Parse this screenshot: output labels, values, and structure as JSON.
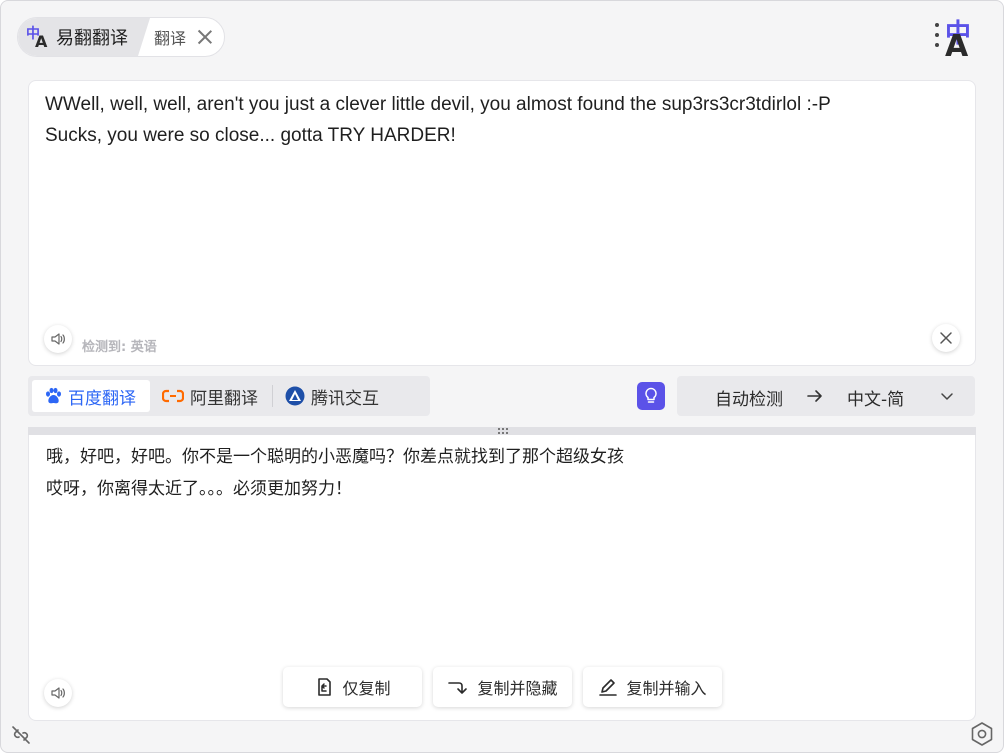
{
  "tabs": [
    {
      "label": "易翻翻译",
      "active": true
    },
    {
      "label": "翻译",
      "active": false
    }
  ],
  "app_glyph": {
    "top": "中",
    "bottom": "A"
  },
  "logo": {
    "top": "中",
    "bottom": "A",
    "icon": "translate-logo-icon"
  },
  "source": {
    "text": "WWell, well, well, aren't you just a clever little devil, you almost found the sup3rs3cr3tdirlol :-P\nSucks, you were so close... gotta TRY HARDER!",
    "detected_label": "检测到: 英语"
  },
  "engines": [
    {
      "label": "百度翻译",
      "icon": "baidu-paw-icon",
      "active": true,
      "color": "#2c66f5"
    },
    {
      "label": "阿里翻译",
      "icon": "alibaba-icon",
      "active": false,
      "color": "#ff6a00"
    },
    {
      "label": "腾讯交互",
      "icon": "tencent-icon",
      "active": false,
      "color": "#1e4fa8"
    }
  ],
  "language": {
    "from": "自动检测",
    "to": "中文-简"
  },
  "target": {
    "text": "哦，好吧，好吧。你不是一个聪明的小恶魔吗？你差点就找到了那个超级女孩\n哎呀，你离得太近了。。。必须更加努力！"
  },
  "actions": [
    {
      "label": "仅复制",
      "icon": "copy-icon"
    },
    {
      "label": "复制并隐藏",
      "icon": "copy-hide-arrow-icon"
    },
    {
      "label": "复制并输入",
      "icon": "pen-icon"
    }
  ],
  "colors": {
    "accent": "#5b52e8",
    "engine_active": "#2c66f5"
  }
}
